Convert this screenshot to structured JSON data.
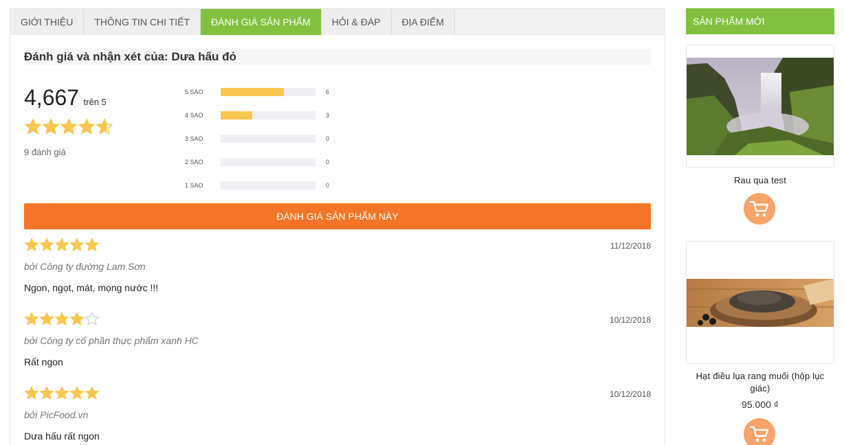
{
  "tabs": [
    {
      "label": "GIỚI THIỆU",
      "active": false
    },
    {
      "label": "THÔNG TIN CHI TIẾT",
      "active": false
    },
    {
      "label": "ĐÁNH GIÁ SẢN PHẨM",
      "active": true
    },
    {
      "label": "HỎI & ĐÁP",
      "active": false
    },
    {
      "label": "ĐỊA ĐIỂM",
      "active": false
    }
  ],
  "review_section": {
    "title": "Đánh giá và nhận xét của: Dưa hấu đỏ",
    "average_score": "4,667",
    "average_out_of": "trên 5",
    "average_rating": 4.667,
    "review_count": "9 đánh giá",
    "distribution": [
      {
        "label": "5 SAO",
        "count": "6",
        "fraction": 0.667
      },
      {
        "label": "4 SAO",
        "count": "3",
        "fraction": 0.333
      },
      {
        "label": "3 SAO",
        "count": "0",
        "fraction": 0
      },
      {
        "label": "2 SAO",
        "count": "0",
        "fraction": 0
      },
      {
        "label": "1 SAO",
        "count": "0",
        "fraction": 0
      }
    ],
    "rate_button_label": "ĐÁNH GIÁ SẢN PHẨM NÀY"
  },
  "reviews": [
    {
      "rating": 5,
      "date": "11/12/2018",
      "author": "bởi Công ty đường Lam Sơn",
      "text": "Ngon, ngọt, mát, mọng nước !!!"
    },
    {
      "rating": 4,
      "date": "10/12/2018",
      "author": "bởi Công ty cổ phần thực phẩm xanh HC",
      "text": "Rất ngon"
    },
    {
      "rating": 5,
      "date": "10/12/2018",
      "author": "bởi PicFood.vn",
      "text": "Dưa hấu rất ngon"
    }
  ],
  "sidebar": {
    "title": "SẢN PHẨM MỚI",
    "products": [
      {
        "name": "Rau qua test",
        "price": ""
      },
      {
        "name": "Hạt điều lụa rang muối (hộp lục giác)",
        "price": "95.000 ₫"
      }
    ]
  },
  "colors": {
    "accent_green": "#82c13f",
    "button_orange": "#f47529",
    "star_yellow": "#f9c74f",
    "cart_orange": "#f6a46a"
  }
}
